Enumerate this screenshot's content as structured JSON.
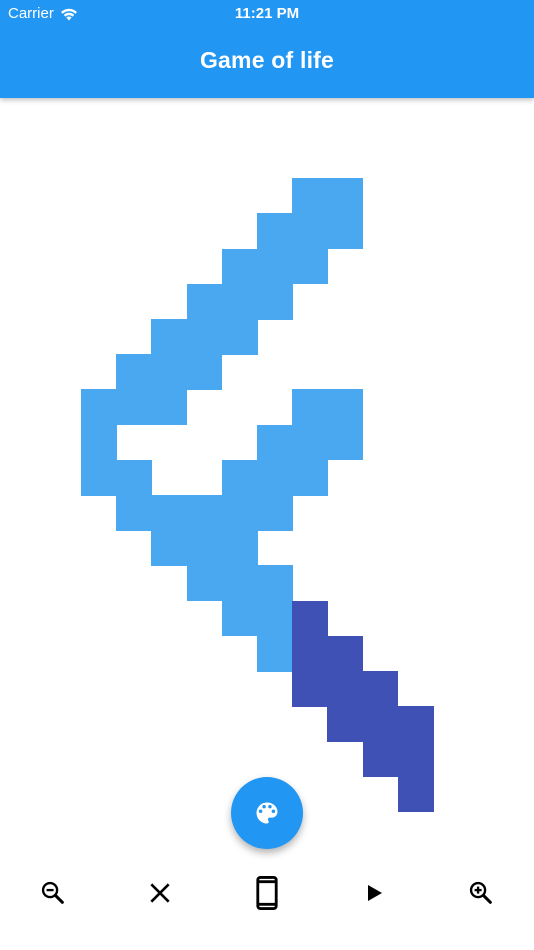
{
  "status_bar": {
    "carrier": "Carrier",
    "time": "11:21 PM"
  },
  "app_bar": {
    "title": "Game of life"
  },
  "colors": {
    "app_bar": "#2196f3",
    "cell_light": "#4aa8f1",
    "cell_dark": "#3f51b5",
    "fab": "#2196f3"
  },
  "board": {
    "live_cells_light": [
      [
        6,
        1
      ],
      [
        7,
        1
      ],
      [
        5,
        2
      ],
      [
        6,
        2
      ],
      [
        7,
        2
      ],
      [
        4,
        3
      ],
      [
        5,
        3
      ],
      [
        6,
        3
      ],
      [
        3,
        4
      ],
      [
        4,
        4
      ],
      [
        5,
        4
      ],
      [
        2,
        5
      ],
      [
        3,
        5
      ],
      [
        4,
        5
      ],
      [
        1,
        6
      ],
      [
        2,
        6
      ],
      [
        3,
        6
      ],
      [
        0,
        7
      ],
      [
        1,
        7
      ],
      [
        2,
        7
      ],
      [
        6,
        7
      ],
      [
        7,
        7
      ],
      [
        0,
        8
      ],
      [
        5,
        8
      ],
      [
        6,
        8
      ],
      [
        7,
        8
      ],
      [
        0,
        9
      ],
      [
        1,
        9
      ],
      [
        4,
        9
      ],
      [
        5,
        9
      ],
      [
        6,
        9
      ],
      [
        1,
        10
      ],
      [
        2,
        10
      ],
      [
        3,
        10
      ],
      [
        4,
        10
      ],
      [
        5,
        10
      ],
      [
        2,
        11
      ],
      [
        3,
        11
      ],
      [
        4,
        11
      ],
      [
        3,
        12
      ],
      [
        4,
        12
      ],
      [
        5,
        12
      ],
      [
        4,
        13
      ],
      [
        5,
        13
      ],
      [
        5,
        14
      ]
    ],
    "live_cells_dark": [
      [
        6,
        13
      ],
      [
        6,
        14
      ],
      [
        7,
        14
      ],
      [
        6,
        15
      ],
      [
        7,
        15
      ],
      [
        8,
        15
      ],
      [
        7,
        16
      ],
      [
        8,
        16
      ],
      [
        9,
        16
      ],
      [
        8,
        17
      ],
      [
        9,
        17
      ],
      [
        9,
        18
      ]
    ]
  },
  "fab": {
    "icon": "palette-icon"
  },
  "bottom_bar": {
    "items": [
      {
        "icon": "zoom-out-icon"
      },
      {
        "icon": "close-icon"
      },
      {
        "icon": "smartphone-icon"
      },
      {
        "icon": "play-icon"
      },
      {
        "icon": "zoom-in-icon"
      }
    ]
  }
}
